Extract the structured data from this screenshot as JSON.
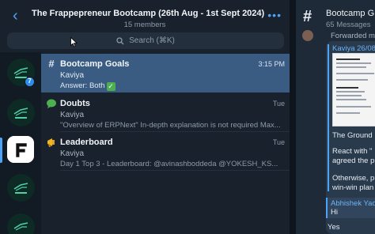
{
  "header": {
    "back_label": "‹",
    "title": "The Frappepreneur Bootcamp (26th Aug - 1st Sept 2024)",
    "subtitle": "15 members",
    "more_label": "•••"
  },
  "search": {
    "placeholder": "Search (⌘K)"
  },
  "rail": {
    "badge_count": "7",
    "selected_index": 2
  },
  "chats": [
    {
      "icon": "#",
      "name": "Bootcamp Goals",
      "time": "3:15 PM",
      "sender": "Kaviya",
      "preview": "Answer: Both",
      "selected": true
    },
    {
      "icon": "speech-bubble-icon",
      "name": "Doubts",
      "time": "Tue",
      "sender": "Kaviya",
      "preview": "\"Overview of ERPNext\"  In-depth explanation is not required  Max..."
    },
    {
      "icon": "megaphone-icon",
      "name": "Leaderboard",
      "time": "Tue",
      "sender": "Kaviya",
      "preview": "Day 1  Top 3 - Leaderboard:  @avinashboddeda  @YOKESH_KS..."
    }
  ],
  "right": {
    "title": "Bootcamp G",
    "subtitle": "65 Messages",
    "forwarded": "Forwarded me",
    "author": "Kaviya 26/08",
    "line1": "The Ground I",
    "line2": "React with \"",
    "line3": "agreed the p",
    "line4": "Otherwise, p",
    "line5": "win-win plan",
    "reply_name": "Abhishek Yad",
    "reply_text": "Hi",
    "yes": "Yes"
  },
  "colors": {
    "accent": "#4da3f5",
    "selected_row": "#3b5c82",
    "check": "#4caf50"
  }
}
